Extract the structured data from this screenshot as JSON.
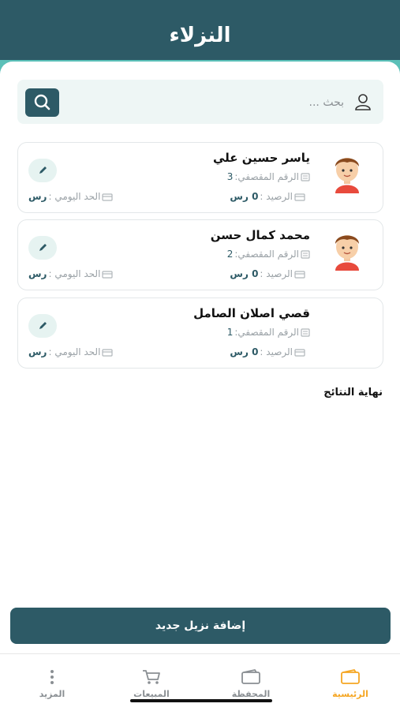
{
  "header": {
    "title": "النزلاء"
  },
  "search": {
    "placeholder": "بحث ...",
    "value": ""
  },
  "guests": [
    {
      "name": "ياسر حسين علي",
      "cell_label": "الرقم المقصفي:",
      "cell_value": "3",
      "balance_label": "الرصيد : ",
      "balance_value": "0 رس",
      "daily_label": "الحد اليومي : ",
      "daily_value": "رس",
      "has_avatar": true
    },
    {
      "name": "محمد كمال حسن",
      "cell_label": "الرقم المقصفي:",
      "cell_value": "2",
      "balance_label": "الرصيد : ",
      "balance_value": "0 رس",
      "daily_label": "الحد اليومي : ",
      "daily_value": "رس",
      "has_avatar": true
    },
    {
      "name": "قصي اصلان الصامل",
      "cell_label": "الرقم المقصفي:",
      "cell_value": "1",
      "balance_label": "الرصيد : ",
      "balance_value": "0 رس",
      "daily_label": "الحد اليومي : ",
      "daily_value": "رس",
      "has_avatar": false
    }
  ],
  "end_of_results": "نهاية النتائج",
  "add_button": "إضافة نزيل جديد",
  "tabs": [
    {
      "label": "الرئيسية",
      "icon": "wallet-icon",
      "active": true
    },
    {
      "label": "المحفظة",
      "icon": "wallet-icon",
      "active": false
    },
    {
      "label": "المبيعات",
      "icon": "cart-icon",
      "active": false
    },
    {
      "label": "المزيد",
      "icon": "more-vertical-icon",
      "active": false
    }
  ],
  "colors": {
    "primary": "#2d5a66",
    "accent": "#5bc0b8",
    "active_tab": "#f5a623",
    "search_bg": "#eef6f5"
  }
}
